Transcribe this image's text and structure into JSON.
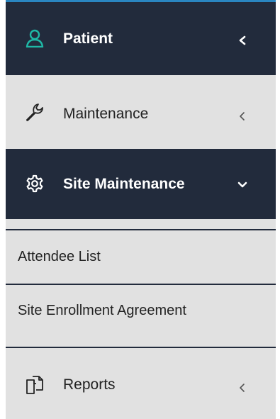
{
  "menu": {
    "items": [
      {
        "label": "Patient",
        "icon": "user-icon",
        "chevron": "chevron-left-icon",
        "active": true
      },
      {
        "label": "Maintenance",
        "icon": "wrench-icon",
        "chevron": "chevron-left-icon",
        "active": false
      },
      {
        "label": "Site Maintenance",
        "icon": "gear-icon",
        "chevron": "chevron-down-icon",
        "active": true,
        "expanded": true
      },
      {
        "label": "Reports",
        "icon": "document-icon",
        "chevron": "chevron-left-icon",
        "active": false
      }
    ],
    "submenu": [
      {
        "label": "Attendee List"
      },
      {
        "label": "Site Enrollment Agreement"
      }
    ]
  },
  "colors": {
    "active_bg": "#222b3c",
    "inactive_bg": "#e1e1e1",
    "accent": "#2a86c1",
    "patient_icon": "#1fb8a6"
  }
}
